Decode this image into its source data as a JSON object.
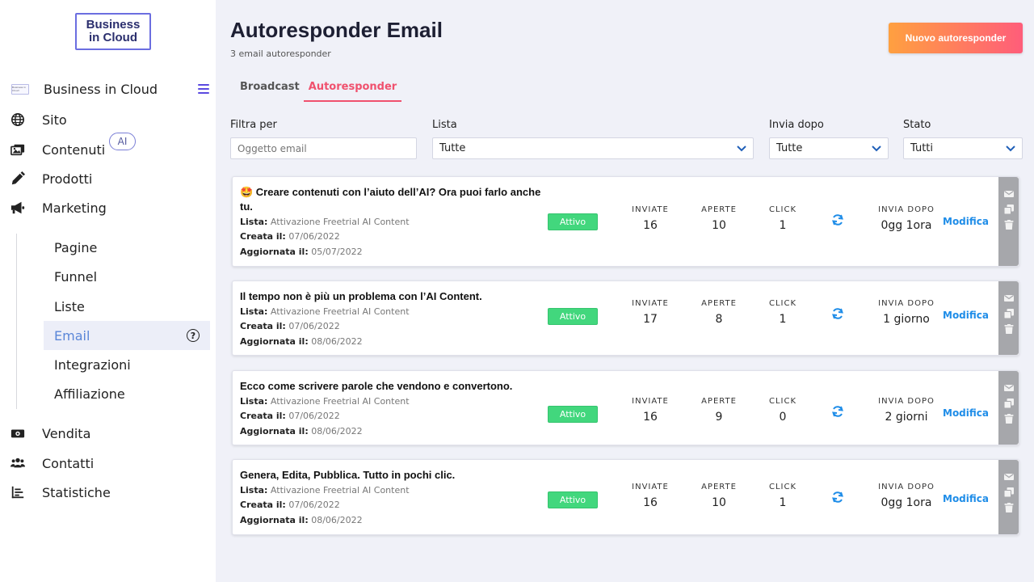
{
  "logo": {
    "line1": "Business",
    "line2": "in Cloud"
  },
  "brand": {
    "label": "Business in Cloud",
    "thumb_text": "Business in Cloud"
  },
  "nav": [
    {
      "label": "Sito",
      "icon": "globe-icon"
    },
    {
      "label": "Contenuti",
      "icon": "images-icon"
    },
    {
      "label": "Prodotti",
      "icon": "pencil-icon"
    },
    {
      "label": "Marketing",
      "icon": "megaphone-icon"
    }
  ],
  "ai_badge": "AI",
  "submenu": [
    "Pagine",
    "Funnel",
    "Liste",
    "Email",
    "Integrazioni",
    "Affiliazione"
  ],
  "nav_bottom": [
    {
      "label": "Vendita",
      "icon": "money-icon"
    },
    {
      "label": "Contatti",
      "icon": "users-icon"
    },
    {
      "label": "Statistiche",
      "icon": "chart-icon"
    }
  ],
  "page": {
    "title": "Autoresponder Email",
    "subtitle": "3 email autoresponder",
    "new_button": "Nuovo autoresponder"
  },
  "tabs": {
    "broadcast": "Broadcast",
    "autoresponder": "Autoresponder"
  },
  "filters": {
    "filter_label": "Filtra per",
    "filter_placeholder": "Oggetto email",
    "list_label": "Lista",
    "list_value": "Tutte",
    "send_after_label": "Invia dopo",
    "send_after_value": "Tutte",
    "status_label": "Stato",
    "status_value": "Tutti"
  },
  "labels": {
    "list": "Lista:",
    "created": "Creata il:",
    "updated": "Aggiornata il:",
    "sent": "INVIATE",
    "opened": "APERTE",
    "click": "CLICK",
    "send_after": "INVIA DOPO",
    "edit": "Modifica"
  },
  "emails": [
    {
      "title": "🤩 Creare contenuti con l’aiuto dell’AI? Ora puoi farlo anche tu.",
      "list": "Attivazione Freetrial AI Content",
      "created": "07/06/2022",
      "updated": "05/07/2022",
      "status": "Attivo",
      "sent": "16",
      "opened": "10",
      "click": "1",
      "send_after": "0gg 1ora"
    },
    {
      "title": "Il tempo non è più un problema con l’AI Content.",
      "list": "Attivazione Freetrial AI Content",
      "created": "07/06/2022",
      "updated": "08/06/2022",
      "status": "Attivo",
      "sent": "17",
      "opened": "8",
      "click": "1",
      "send_after": "1 giorno"
    },
    {
      "title": "Ecco come scrivere parole che vendono e convertono.",
      "list": "Attivazione Freetrial AI Content",
      "created": "07/06/2022",
      "updated": "08/06/2022",
      "status": "Attivo",
      "sent": "16",
      "opened": "9",
      "click": "0",
      "send_after": "2 giorni"
    },
    {
      "title": "Genera, Edita, Pubblica. Tutto in pochi clic.",
      "list": "Attivazione Freetrial AI Content",
      "created": "07/06/2022",
      "updated": "08/06/2022",
      "status": "Attivo",
      "sent": "16",
      "opened": "10",
      "click": "1",
      "send_after": "0gg 1ora"
    }
  ],
  "colors": {
    "accent": "#f0516e",
    "active_status": "#42d77d",
    "link": "#1f8de8",
    "active_nav": "#5a86d8"
  }
}
